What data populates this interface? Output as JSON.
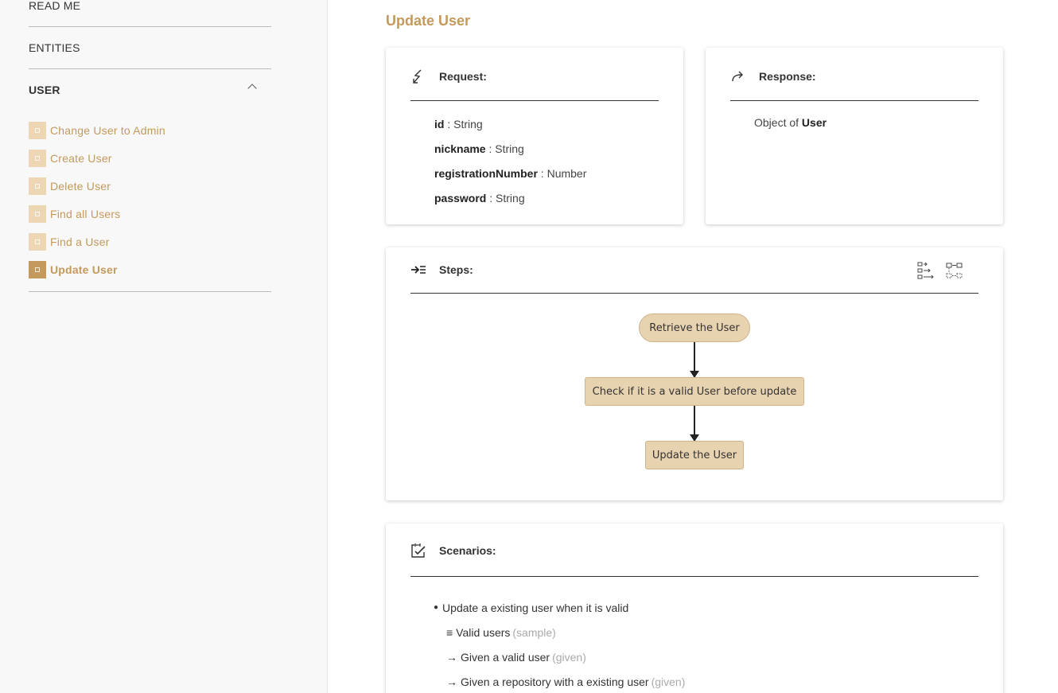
{
  "sidebar": {
    "readme_label": "READ ME",
    "entities_label": "ENTITIES",
    "user_label": "USER",
    "items": [
      {
        "label": "Change User to Admin",
        "active": false
      },
      {
        "label": "Create User",
        "active": false
      },
      {
        "label": "Delete User",
        "active": false
      },
      {
        "label": "Find all Users",
        "active": false
      },
      {
        "label": "Find a User",
        "active": false
      },
      {
        "label": "Update User",
        "active": true
      }
    ]
  },
  "main": {
    "title": "Update User",
    "request": {
      "title": "Request:",
      "fields": [
        {
          "name": "id",
          "type": " : String"
        },
        {
          "name": "nickname",
          "type": " : String"
        },
        {
          "name": "registrationNumber",
          "type": " : Number"
        },
        {
          "name": "password",
          "type": " : String"
        }
      ]
    },
    "response": {
      "title": "Response:",
      "prefix": "Object of ",
      "type": "User"
    },
    "steps": {
      "title": "Steps:",
      "nodes": [
        "Retrieve the User",
        "Check if it is a valid User before update",
        "Update the User"
      ]
    },
    "scenarios": {
      "title": "Scenarios:",
      "scenario_title": "Update a existing user when it is valid",
      "items": [
        {
          "glyph": "≡",
          "text": "Valid users",
          "tag": "(sample)"
        },
        {
          "glyph": "→",
          "text": "Given a valid user",
          "tag": "(given)"
        },
        {
          "glyph": "→",
          "text": "Given a repository with a existing user",
          "tag": "(given)"
        }
      ]
    }
  },
  "colors": {
    "accent": "#c49a5c",
    "accent_light": "#ecd6b3",
    "node_fill": "#e8d3b1"
  }
}
